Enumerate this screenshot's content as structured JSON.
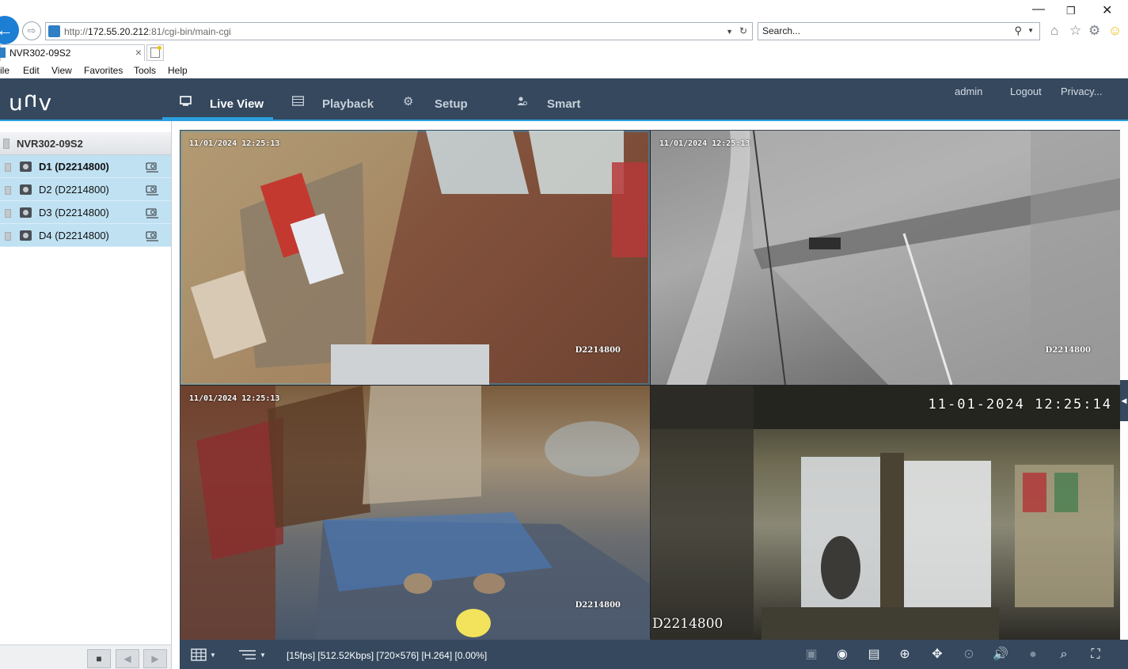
{
  "browser": {
    "url_prefix": "http://",
    "url_host": "172.55.20.212",
    "url_rest": ":81/cgi-bin/main-cgi",
    "search_placeholder": "Search...",
    "tab_title": "NVR302-09S2",
    "tab_close": "×",
    "menu": [
      "ile",
      "Edit",
      "View",
      "Favorites",
      "Tools",
      "Help"
    ],
    "window_controls": {
      "minimize": "—",
      "restore": "❐",
      "close": "✕"
    }
  },
  "header": {
    "logo": "UNV",
    "tabs": [
      {
        "label": "Live View",
        "icon": "monitor-icon",
        "active": true
      },
      {
        "label": "Playback",
        "icon": "film-icon",
        "active": false
      },
      {
        "label": "Setup",
        "icon": "gear-icon",
        "active": false
      },
      {
        "label": "Smart",
        "icon": "person-scan-icon",
        "active": false
      }
    ],
    "user": "admin",
    "logout": "Logout",
    "privacy": "Privacy..."
  },
  "sidebar": {
    "device_name": "NVR302-09S2",
    "cameras": [
      {
        "label": "D1 (D2214800)",
        "selected": true
      },
      {
        "label": "D2 (D2214800)",
        "selected": false
      },
      {
        "label": "D3 (D2214800)",
        "selected": false
      },
      {
        "label": "D4 (D2214800)",
        "selected": false
      }
    ],
    "footer_buttons": {
      "stop": "■",
      "prev": "◀",
      "next": "▶"
    }
  },
  "video": {
    "tiles": [
      {
        "id": "D1",
        "timestamp": "11/01/2024 12:25:13",
        "name": "D2214800"
      },
      {
        "id": "D2",
        "timestamp": "11/01/2024 12:25:13",
        "name": "D2214800"
      },
      {
        "id": "D3",
        "timestamp": "11/01/2024 12:25:13",
        "name": "D2214800"
      },
      {
        "id": "D4",
        "timestamp": "11-01-2024 12:25:14",
        "name": "D2214800"
      }
    ]
  },
  "toolbar": {
    "stream_info": "[15fps] [512.52Kbps] [720×576] [H.264] [0.00%]",
    "layout_icon": "grid-icon",
    "stream_icon": "stream-mode-icon",
    "controls": [
      "aspect-ratio-icon",
      "snapshot-icon",
      "record-clip-icon",
      "digital-zoom-icon",
      "ptz-icon",
      "3d-position-icon",
      "audio-icon",
      "talk-icon",
      "3d-zoom-icon",
      "fullscreen-icon"
    ]
  },
  "colors": {
    "header_bg": "#35485e",
    "accent": "#2ca0e0",
    "sidebar_selected": "#bfe1f2"
  }
}
